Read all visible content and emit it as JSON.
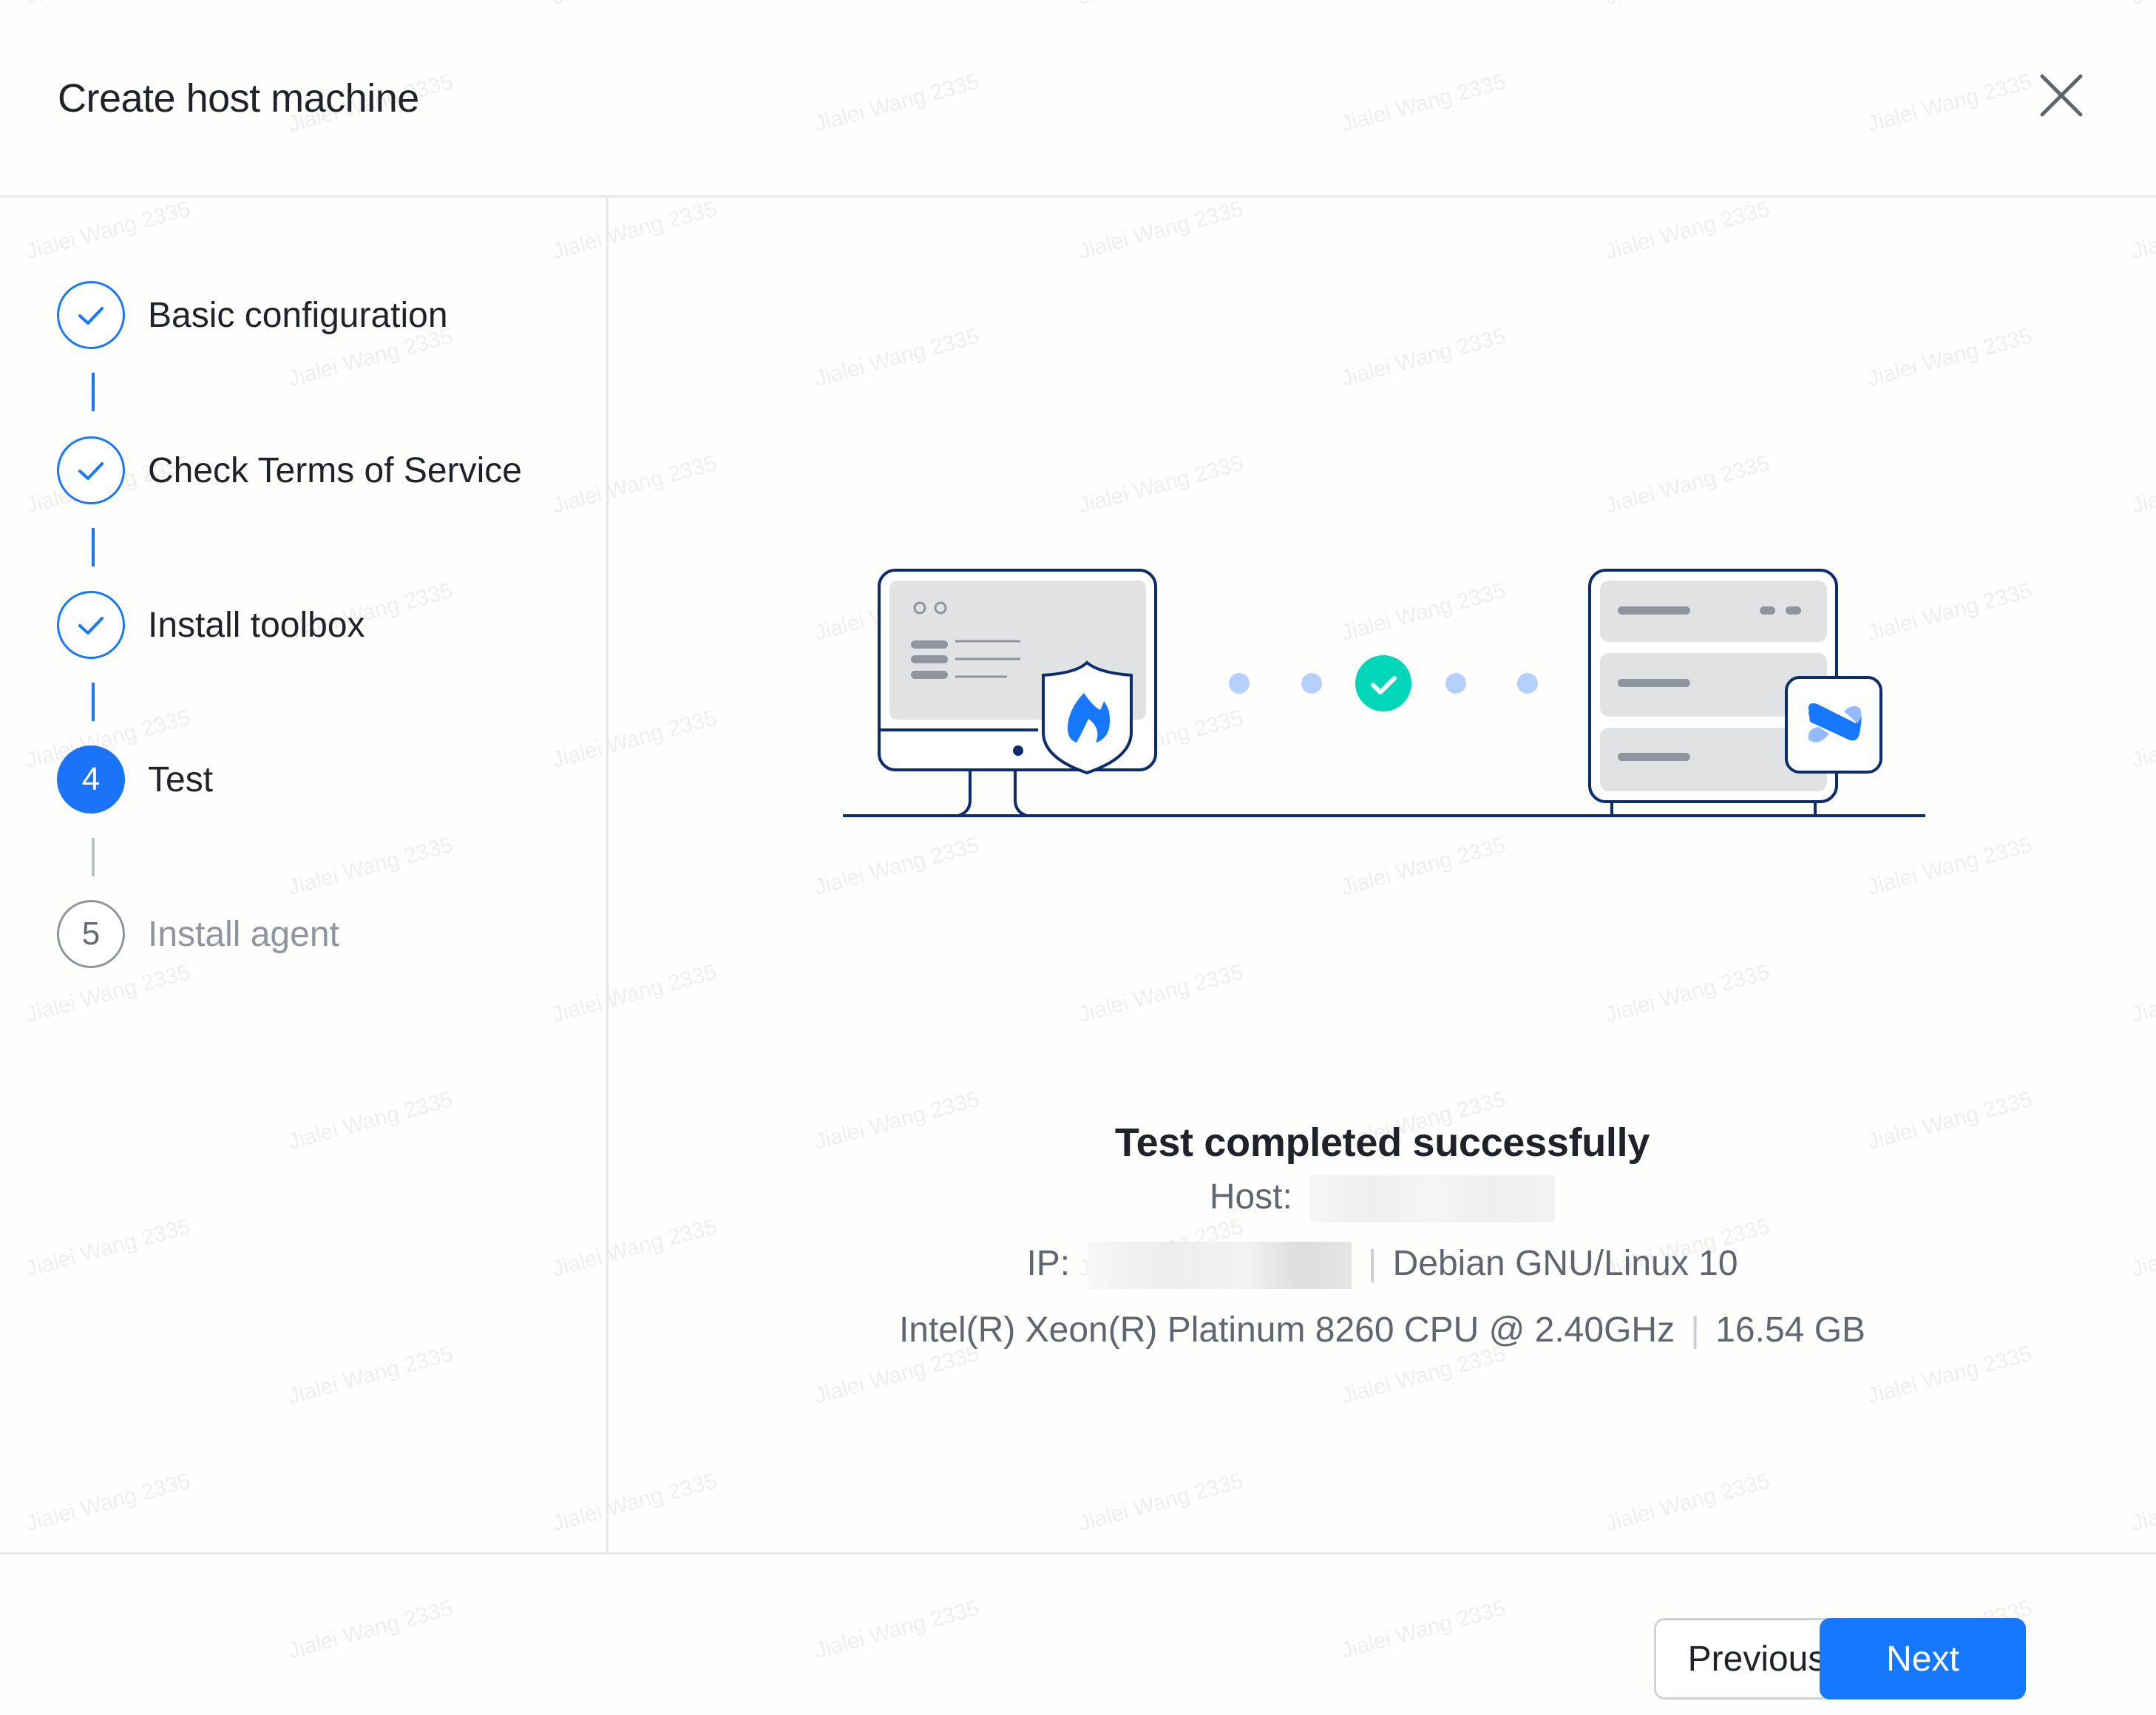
{
  "dialog": {
    "title": "Create host machine",
    "close_icon": "close-icon"
  },
  "watermark": {
    "text": "Jialei Wang 2335"
  },
  "steps": [
    {
      "index": "1",
      "label": "Basic configuration",
      "status": "done",
      "icon": "check-icon"
    },
    {
      "index": "2",
      "label": "Check Terms of Service",
      "status": "done",
      "icon": "check-icon"
    },
    {
      "index": "3",
      "label": "Install toolbox",
      "status": "done",
      "icon": "check-icon"
    },
    {
      "index": "4",
      "label": "Test",
      "status": "active"
    },
    {
      "index": "5",
      "label": "Install agent",
      "status": "wait"
    }
  ],
  "illustration": {
    "left_device": "monitor-with-firewall-shield-icon",
    "connection_status_icon": "success-check-icon",
    "right_device": "server-with-agent-badge-icon"
  },
  "result": {
    "title": "Test completed successfully",
    "host_label": "Host:",
    "host_value_redacted": true,
    "ip_label": "IP:",
    "ip_value_redacted": true,
    "os": "Debian GNU/Linux 10",
    "cpu": "Intel(R) Xeon(R) Platinum 8260 CPU @ 2.40GHz",
    "memory": "16.54 GB",
    "separator": "|"
  },
  "footer": {
    "previous_label": "Previous",
    "next_label": "Next"
  },
  "colors": {
    "primary": "#1677ff",
    "success": "#00d6b9",
    "illustration_stroke": "#0d2c6e",
    "dot": "#b5cfff"
  }
}
